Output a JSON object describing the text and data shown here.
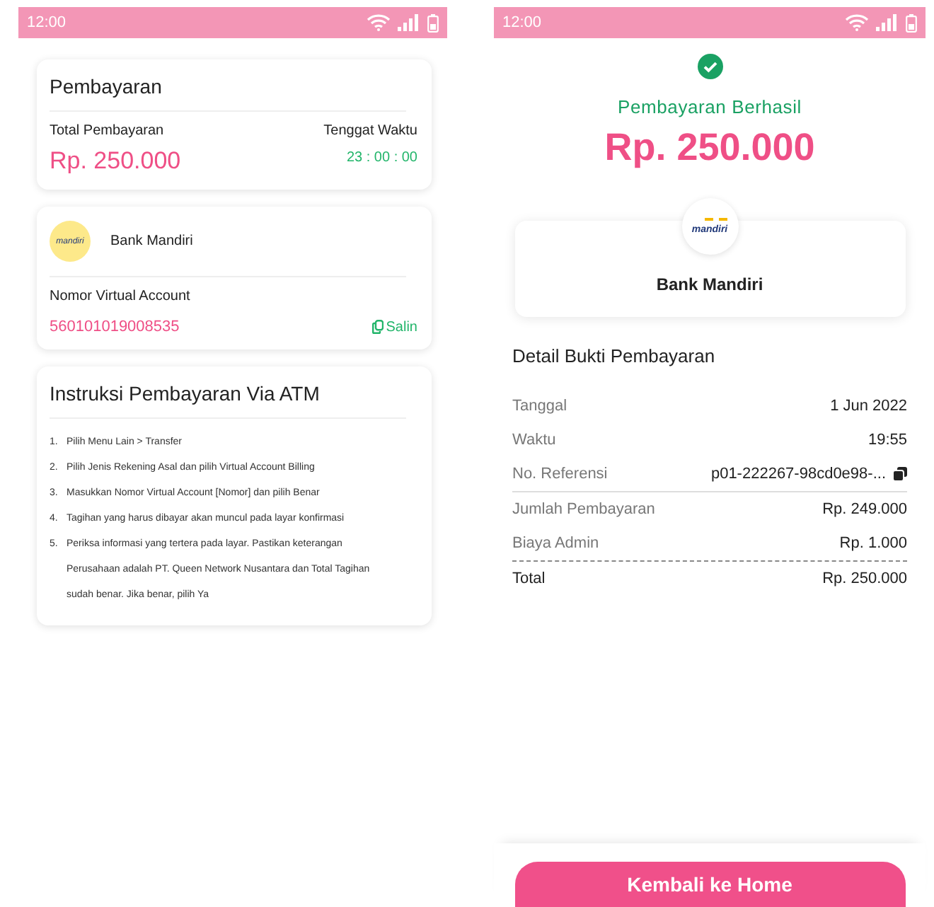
{
  "left_screen": {
    "status_bar": {
      "time": "12:00"
    },
    "payment_card": {
      "title": "Pembayaran",
      "total_label": "Total Pembayaran",
      "total_value": "Rp. 250.000",
      "deadline_label": "Tenggat Waktu",
      "deadline_value": "23 : 00 : 00"
    },
    "bank_card": {
      "logo_text": "mandiri",
      "bank_name": "Bank Mandiri",
      "va_label": "Nomor Virtual Account",
      "va_number": "560101019008535",
      "copy_label": "Salin"
    },
    "instructions": {
      "title": "Instruksi Pembayaran Via ATM",
      "steps": [
        {
          "number": "1.",
          "text": "Pilih Menu Lain > Transfer"
        },
        {
          "number": "2.",
          "text": "Pilih Jenis Rekening Asal dan pilih Virtual Account Billing"
        },
        {
          "number": "3.",
          "text": "Masukkan Nomor Virtual Account [Nomor] dan pilih Benar"
        },
        {
          "number": "4.",
          "text": "Tagihan yang harus dibayar akan muncul pada layar konfirmasi"
        },
        {
          "number": "5.",
          "text": "Periksa informasi yang tertera pada layar. Pastikan keterangan Perusahaan adalah PT. Queen Network Nusantara dan Total Tagihan sudah benar. Jika benar, pilih Ya"
        }
      ]
    }
  },
  "right_screen": {
    "status_bar": {
      "time": "12:00"
    },
    "status_title": "Pembayaran Berhasil",
    "amount": "Rp. 250.000",
    "bank_card": {
      "logo_text": "mandiri",
      "bank_name": "Bank Mandiri"
    },
    "details": {
      "title": "Detail Bukti Pembayaran",
      "rows": [
        {
          "label": "Tanggal",
          "value": "1 Jun 2022",
          "kind": "plain",
          "copyable": false
        },
        {
          "label": "Waktu",
          "value": "19:55",
          "kind": "plain",
          "copyable": false
        },
        {
          "label": "No. Referensi",
          "value": "p01-222267-98cd0e98-...",
          "kind": "solid-divider",
          "copyable": true
        },
        {
          "label": "Jumlah Pembayaran",
          "value": "Rp. 249.000",
          "kind": "plain",
          "copyable": false
        },
        {
          "label": "Biaya Admin",
          "value": "Rp. 1.000",
          "kind": "dashed-divider",
          "copyable": false
        },
        {
          "label": "Total",
          "value": "Rp. 250.000",
          "kind": "total",
          "copyable": false
        }
      ]
    },
    "home_button": "Kembali ke Home"
  }
}
